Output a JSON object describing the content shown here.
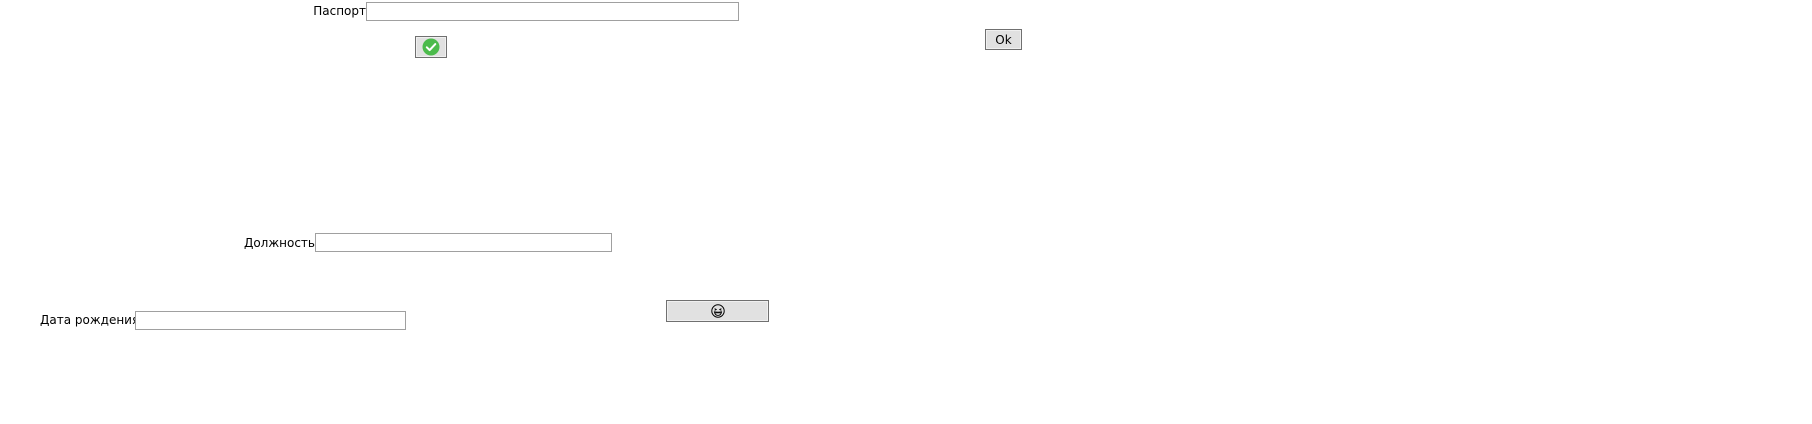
{
  "form": {
    "passport": {
      "label": "Паспорт",
      "value": "",
      "placeholder": ""
    },
    "position": {
      "label": "Должность",
      "value": "",
      "placeholder": ""
    },
    "birth_date": {
      "label": "Дата рождения",
      "value": "",
      "placeholder": ""
    }
  },
  "buttons": {
    "ok_label": "Ok",
    "check_icon": "check-circle-icon",
    "emoji_icon": "grinning-squint-face-icon"
  },
  "colors": {
    "check_green": "#4cbb4c",
    "button_face": "#e1e1e1",
    "input_border": "#a0a0a0"
  }
}
